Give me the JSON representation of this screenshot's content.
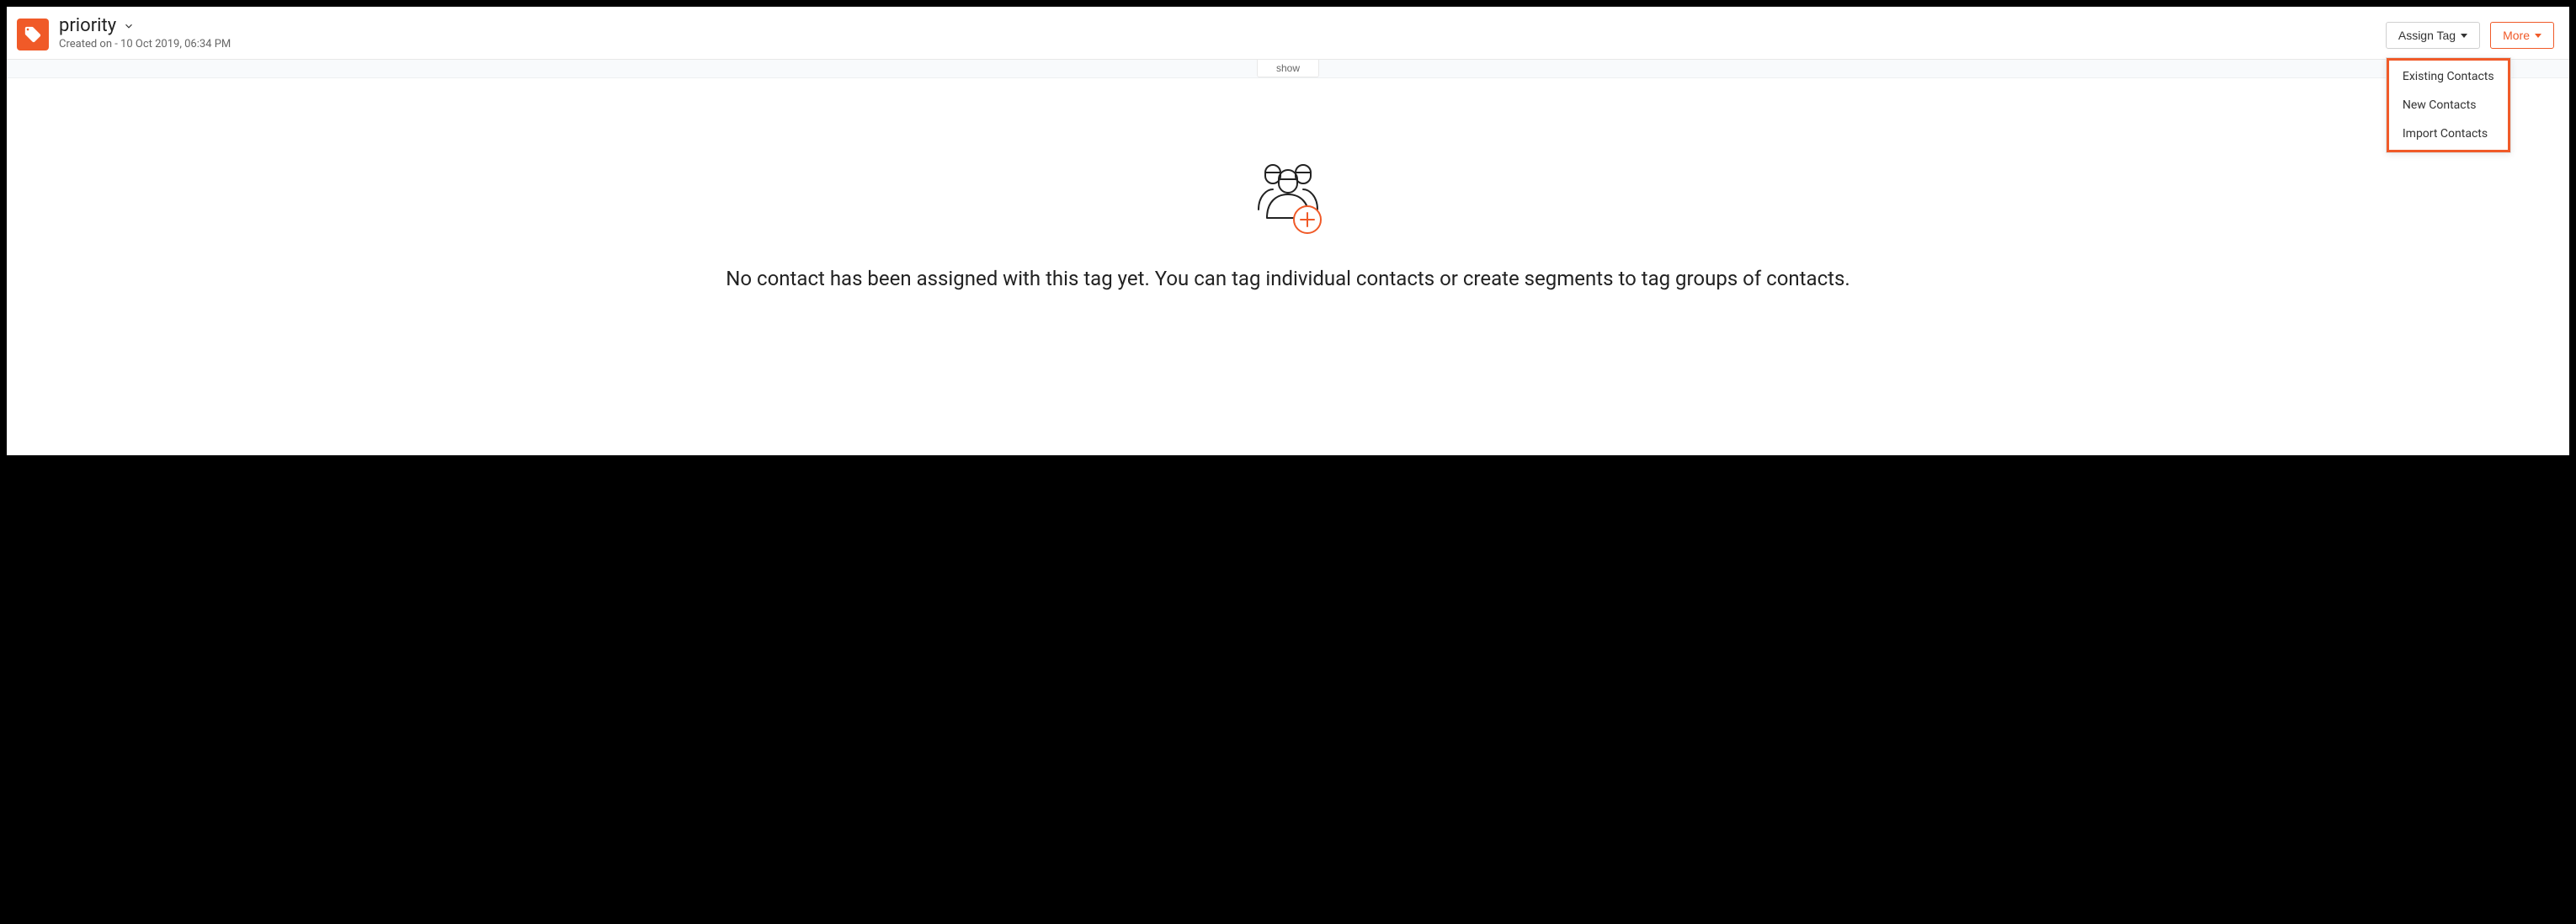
{
  "header": {
    "title": "priority",
    "subtitle": "Created on - 10 Oct 2019, 06:34 PM",
    "assign_tag_label": "Assign Tag",
    "more_label": "More"
  },
  "dropdown": {
    "items": [
      {
        "label": "Existing Contacts"
      },
      {
        "label": "New Contacts"
      },
      {
        "label": "Import Contacts"
      }
    ]
  },
  "show_bar": {
    "label": "show"
  },
  "empty_state": {
    "message": "No contact has been assigned with this tag yet. You can tag individual contacts or create segments to tag groups of contacts."
  }
}
